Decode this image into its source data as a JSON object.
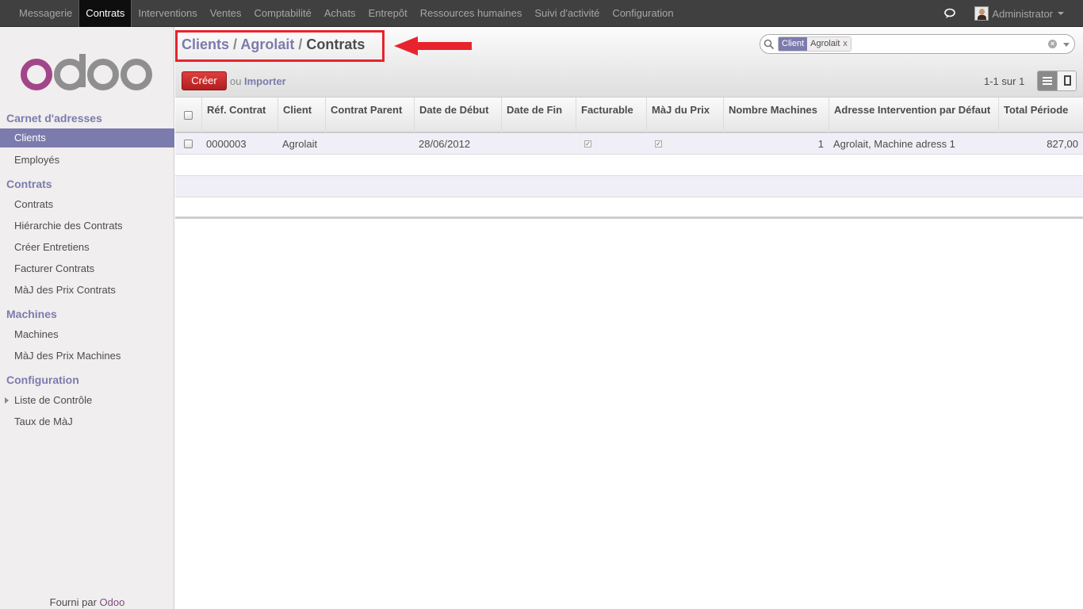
{
  "topnav": {
    "items": [
      "Messagerie",
      "Contrats",
      "Interventions",
      "Ventes",
      "Comptabilité",
      "Achats",
      "Entrepôt",
      "Ressources humaines",
      "Suivi d'activité",
      "Configuration"
    ],
    "active": "Contrats",
    "user": "Administrator"
  },
  "sidebar": {
    "logo_text": "odoo",
    "sections": [
      {
        "title": "Carnet d'adresses",
        "items": [
          "Clients",
          "Employés"
        ]
      },
      {
        "title": "Contrats",
        "items": [
          "Contrats",
          "Hiérarchie des Contrats",
          "Créer Entretiens",
          "Facturer Contrats",
          "MàJ des Prix Contrats"
        ]
      },
      {
        "title": "Machines",
        "items": [
          "Machines",
          "MàJ des Prix Machines"
        ]
      },
      {
        "title": "Configuration",
        "items": [
          "Liste de Contrôle",
          "Taux de MàJ"
        ]
      }
    ],
    "active_item": "Clients",
    "footer_prefix": "Fourni par",
    "footer_brand": "Odoo"
  },
  "header": {
    "breadcrumb": [
      "Clients",
      "Agrolait",
      "Contrats"
    ],
    "search": {
      "facet_label": "Client",
      "facet_value": "Agrolait",
      "facet_remove": "x"
    },
    "create_label": "Créer",
    "or_label": "ou",
    "import_label": "Importer",
    "pager": "1-1 sur 1"
  },
  "table": {
    "columns": [
      "Réf. Contrat",
      "Client",
      "Contrat Parent",
      "Date de Début",
      "Date de Fin",
      "Facturable",
      "MàJ du Prix",
      "Nombre Machines",
      "Adresse Intervention par Défaut",
      "Total Période"
    ],
    "rows": [
      {
        "ref": "0000003",
        "client": "Agrolait",
        "parent": "",
        "start": "28/06/2012",
        "end": "",
        "billable": true,
        "price_update": true,
        "machines": "1",
        "address": "Agrolait, Machine adress 1",
        "total": "827,00"
      }
    ]
  },
  "colors": {
    "accent": "#7c7bad",
    "create_button": "#c52a2a",
    "topbar": "#404040",
    "annotation": "#e8232d"
  }
}
